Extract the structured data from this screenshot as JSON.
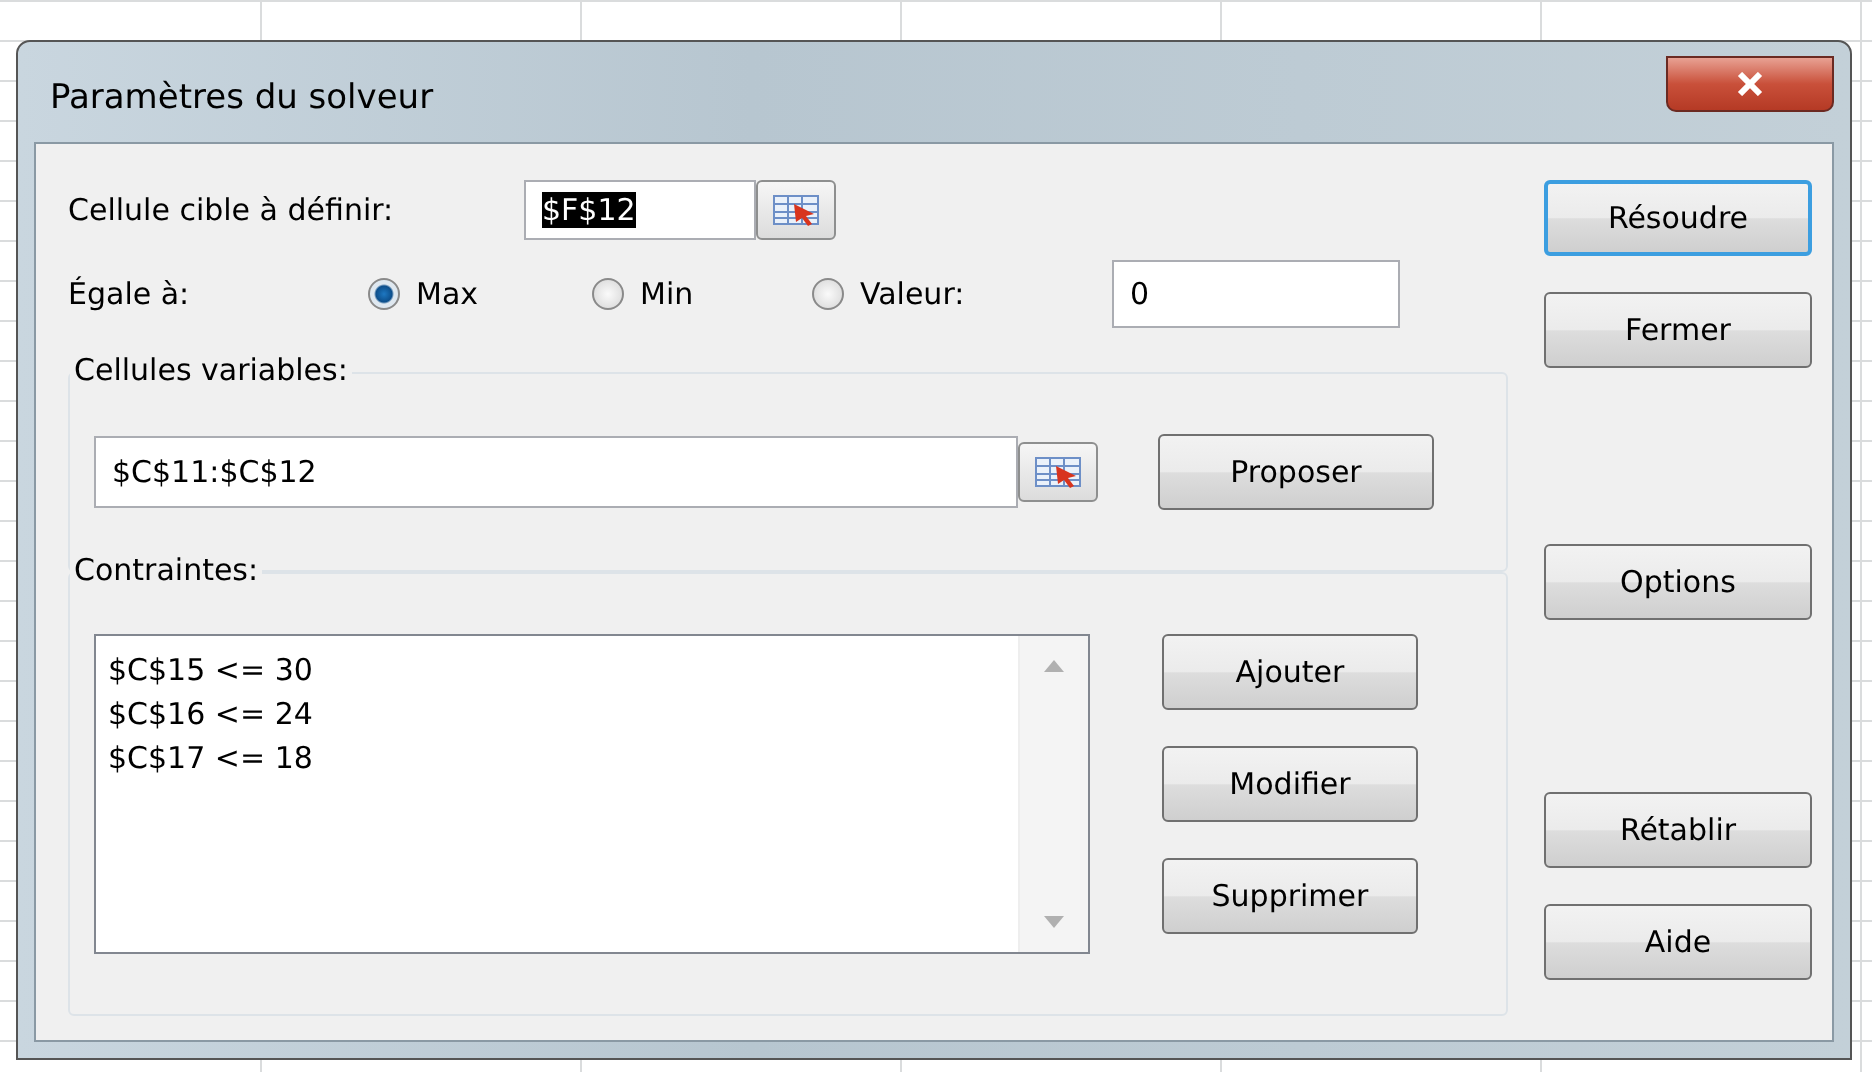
{
  "window": {
    "title": "Paramètres du solveur"
  },
  "target": {
    "label": "Cellule cible à définir:",
    "value": "$F$12",
    "value_selected": true
  },
  "equal_to": {
    "label": "Égale à:",
    "options": [
      {
        "label": "Max",
        "selected": true
      },
      {
        "label": "Min",
        "selected": false
      },
      {
        "label": "Valeur:",
        "selected": false
      }
    ],
    "value": "0"
  },
  "variable_cells": {
    "label": "Cellules variables:",
    "value": "$C$11:$C$12",
    "button": {
      "label": "Proposer"
    }
  },
  "constraints": {
    "label": "Contraintes:",
    "items": [
      "$C$15 <= 30",
      "$C$16 <= 24",
      "$C$17 <= 18"
    ],
    "buttons": [
      {
        "label": "Ajouter"
      },
      {
        "label": "Modifier"
      },
      {
        "label": "Supprimer"
      }
    ]
  },
  "side_buttons": [
    {
      "label": "Résoudre",
      "focused": true
    },
    {
      "label": "Fermer",
      "focused": false
    },
    {
      "label": "Options",
      "focused": false
    },
    {
      "label": "Rétablir",
      "focused": false
    },
    {
      "label": "Aide",
      "focused": false
    }
  ]
}
